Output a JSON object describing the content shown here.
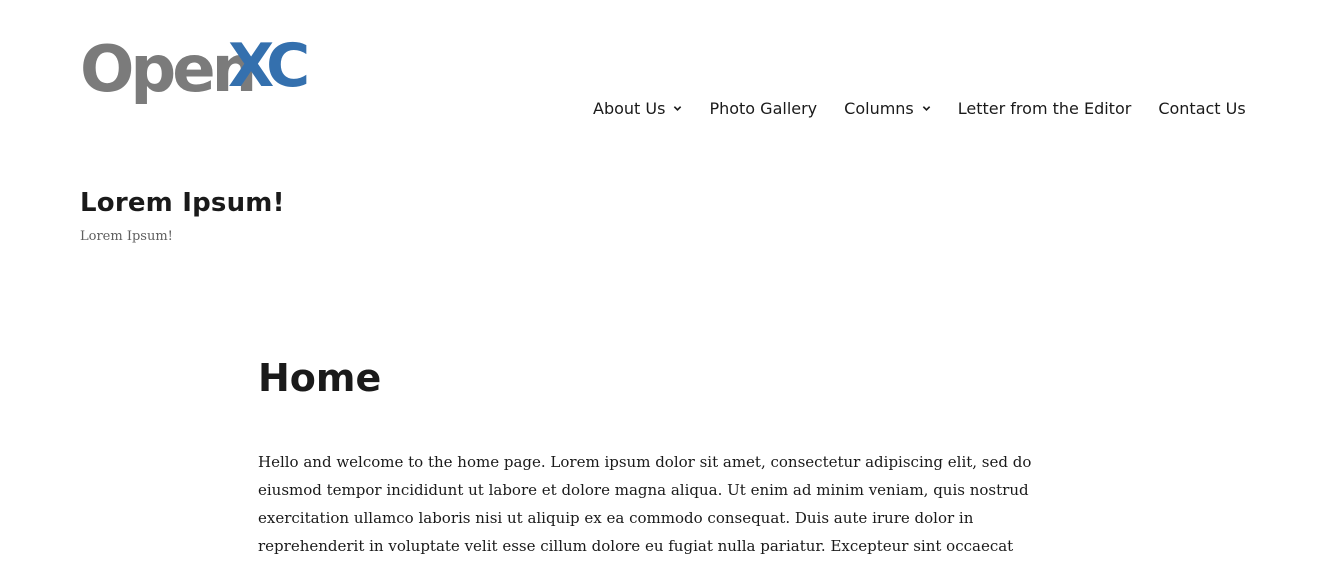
{
  "logo": {
    "text_part1": "Open",
    "text_part2": "XC",
    "colors": {
      "gray": "#7b7b7b",
      "blue": "#3470ae"
    }
  },
  "nav": {
    "items": [
      {
        "label": "About Us",
        "has_submenu": true
      },
      {
        "label": "Photo Gallery",
        "has_submenu": false
      },
      {
        "label": "Columns",
        "has_submenu": true
      },
      {
        "label": "Letter from the Editor",
        "has_submenu": false
      },
      {
        "label": "Contact Us",
        "has_submenu": false
      }
    ]
  },
  "site": {
    "title": "Lorem Ipsum!",
    "tagline": "Lorem Ipsum!"
  },
  "page": {
    "title": "Home",
    "body": "Hello and welcome to the home page. Lorem ipsum dolor sit amet, consectetur adipiscing elit, sed do eiusmod tempor incididunt ut labore et dolore magna aliqua. Ut enim ad minim veniam, quis nostrud exercitation ullamco laboris nisi ut aliquip ex ea commodo consequat. Duis aute irure dolor in reprehenderit in voluptate velit esse cillum dolore eu fugiat nulla pariatur. Excepteur sint occaecat"
  },
  "colors": {
    "text": "#1a1a1a",
    "tagline": "#5f5f5f",
    "background": "#ffffff"
  },
  "icons": {
    "submenu_toggle": "chevron-down-icon"
  }
}
